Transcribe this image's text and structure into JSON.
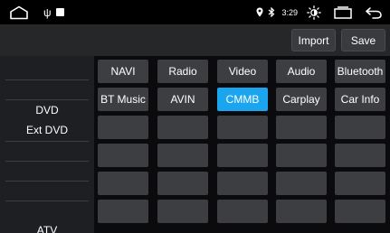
{
  "status_bar": {
    "time": "3:29",
    "icons": [
      "home-icon",
      "usb-icon",
      "notification-square-icon",
      "location-icon",
      "bluetooth-icon",
      "brightness-icon",
      "recent-apps-icon",
      "back-icon"
    ]
  },
  "toolbar": {
    "import_label": "Import",
    "save_label": "Save"
  },
  "left_list": {
    "items": [
      "DVD",
      "Ext DVD",
      "ATV"
    ]
  },
  "grid": {
    "rows": [
      [
        "NAVI",
        "Radio",
        "Video",
        "Audio",
        "Bluetooth"
      ],
      [
        "BT Music",
        "AVIN",
        "CMMB",
        "Carplay",
        "Car Info"
      ],
      [
        "",
        "",
        "",
        "",
        ""
      ],
      [
        "",
        "",
        "",
        "",
        ""
      ],
      [
        "",
        "",
        "",
        "",
        ""
      ],
      [
        "",
        "",
        "",
        "",
        ""
      ]
    ],
    "selected": "CMMB"
  },
  "colors": {
    "accent": "#1aa5ee",
    "button": "#3d3e41",
    "toolbar": "#262729",
    "list_bg": "#1e1f22",
    "status_bg": "#000000"
  }
}
